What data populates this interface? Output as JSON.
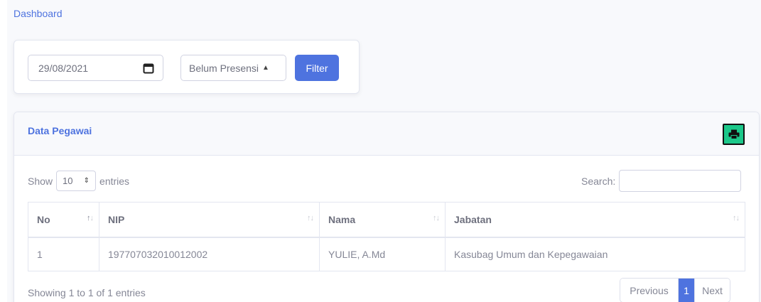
{
  "breadcrumb": "Dashboard",
  "filter": {
    "date_value": "29/08/2021",
    "status_selected": "Belum Presensi",
    "filter_label": "Filter"
  },
  "card": {
    "title": "Data Pegawai",
    "print_icon": "print-icon"
  },
  "table_controls": {
    "show_label": "Show",
    "length_value": "10",
    "entries_label": "entries",
    "search_label": "Search:"
  },
  "table": {
    "columns": [
      "No",
      "NIP",
      "Nama",
      "Jabatan"
    ],
    "rows": [
      [
        "1",
        "197707032010012002",
        "YULIE, A.Md",
        "Kasubag Umum dan Kepegawaian"
      ]
    ]
  },
  "footer": {
    "info": "Showing 1 to 1 of 1 entries",
    "previous_label": "Previous",
    "current_page": "1",
    "next_label": "Next"
  },
  "colors": {
    "primary": "#4e73df",
    "success": "#1cc88a"
  }
}
